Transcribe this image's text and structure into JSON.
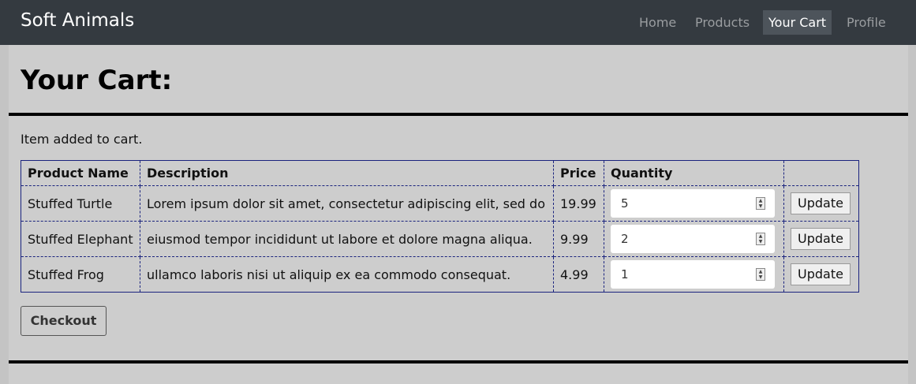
{
  "navbar": {
    "brand": "Soft Animals",
    "items": [
      {
        "label": "Home",
        "active": false
      },
      {
        "label": "Products",
        "active": false
      },
      {
        "label": "Your Cart",
        "active": true
      },
      {
        "label": "Profile",
        "active": false
      }
    ]
  },
  "page": {
    "title": "Your Cart:",
    "status": "Item added to cart."
  },
  "cart": {
    "headers": [
      "Product Name",
      "Description",
      "Price",
      "Quantity",
      ""
    ],
    "rows": [
      {
        "name": "Stuffed Turtle",
        "description": "Lorem ipsum dolor sit amet, consectetur adipiscing elit, sed do",
        "price": "19.99",
        "quantity": "5",
        "update_label": "Update"
      },
      {
        "name": "Stuffed Elephant",
        "description": "eiusmod tempor incididunt ut labore et dolore magna aliqua.",
        "price": "9.99",
        "quantity": "2",
        "update_label": "Update"
      },
      {
        "name": "Stuffed Frog",
        "description": "ullamco laboris nisi ut aliquip ex ea commodo consequat.",
        "price": "4.99",
        "quantity": "1",
        "update_label": "Update"
      }
    ]
  },
  "checkout_label": "Checkout",
  "colors": {
    "navbar": "#343a40",
    "active_tab": "#4d545b",
    "table_border": "#1a237e"
  }
}
